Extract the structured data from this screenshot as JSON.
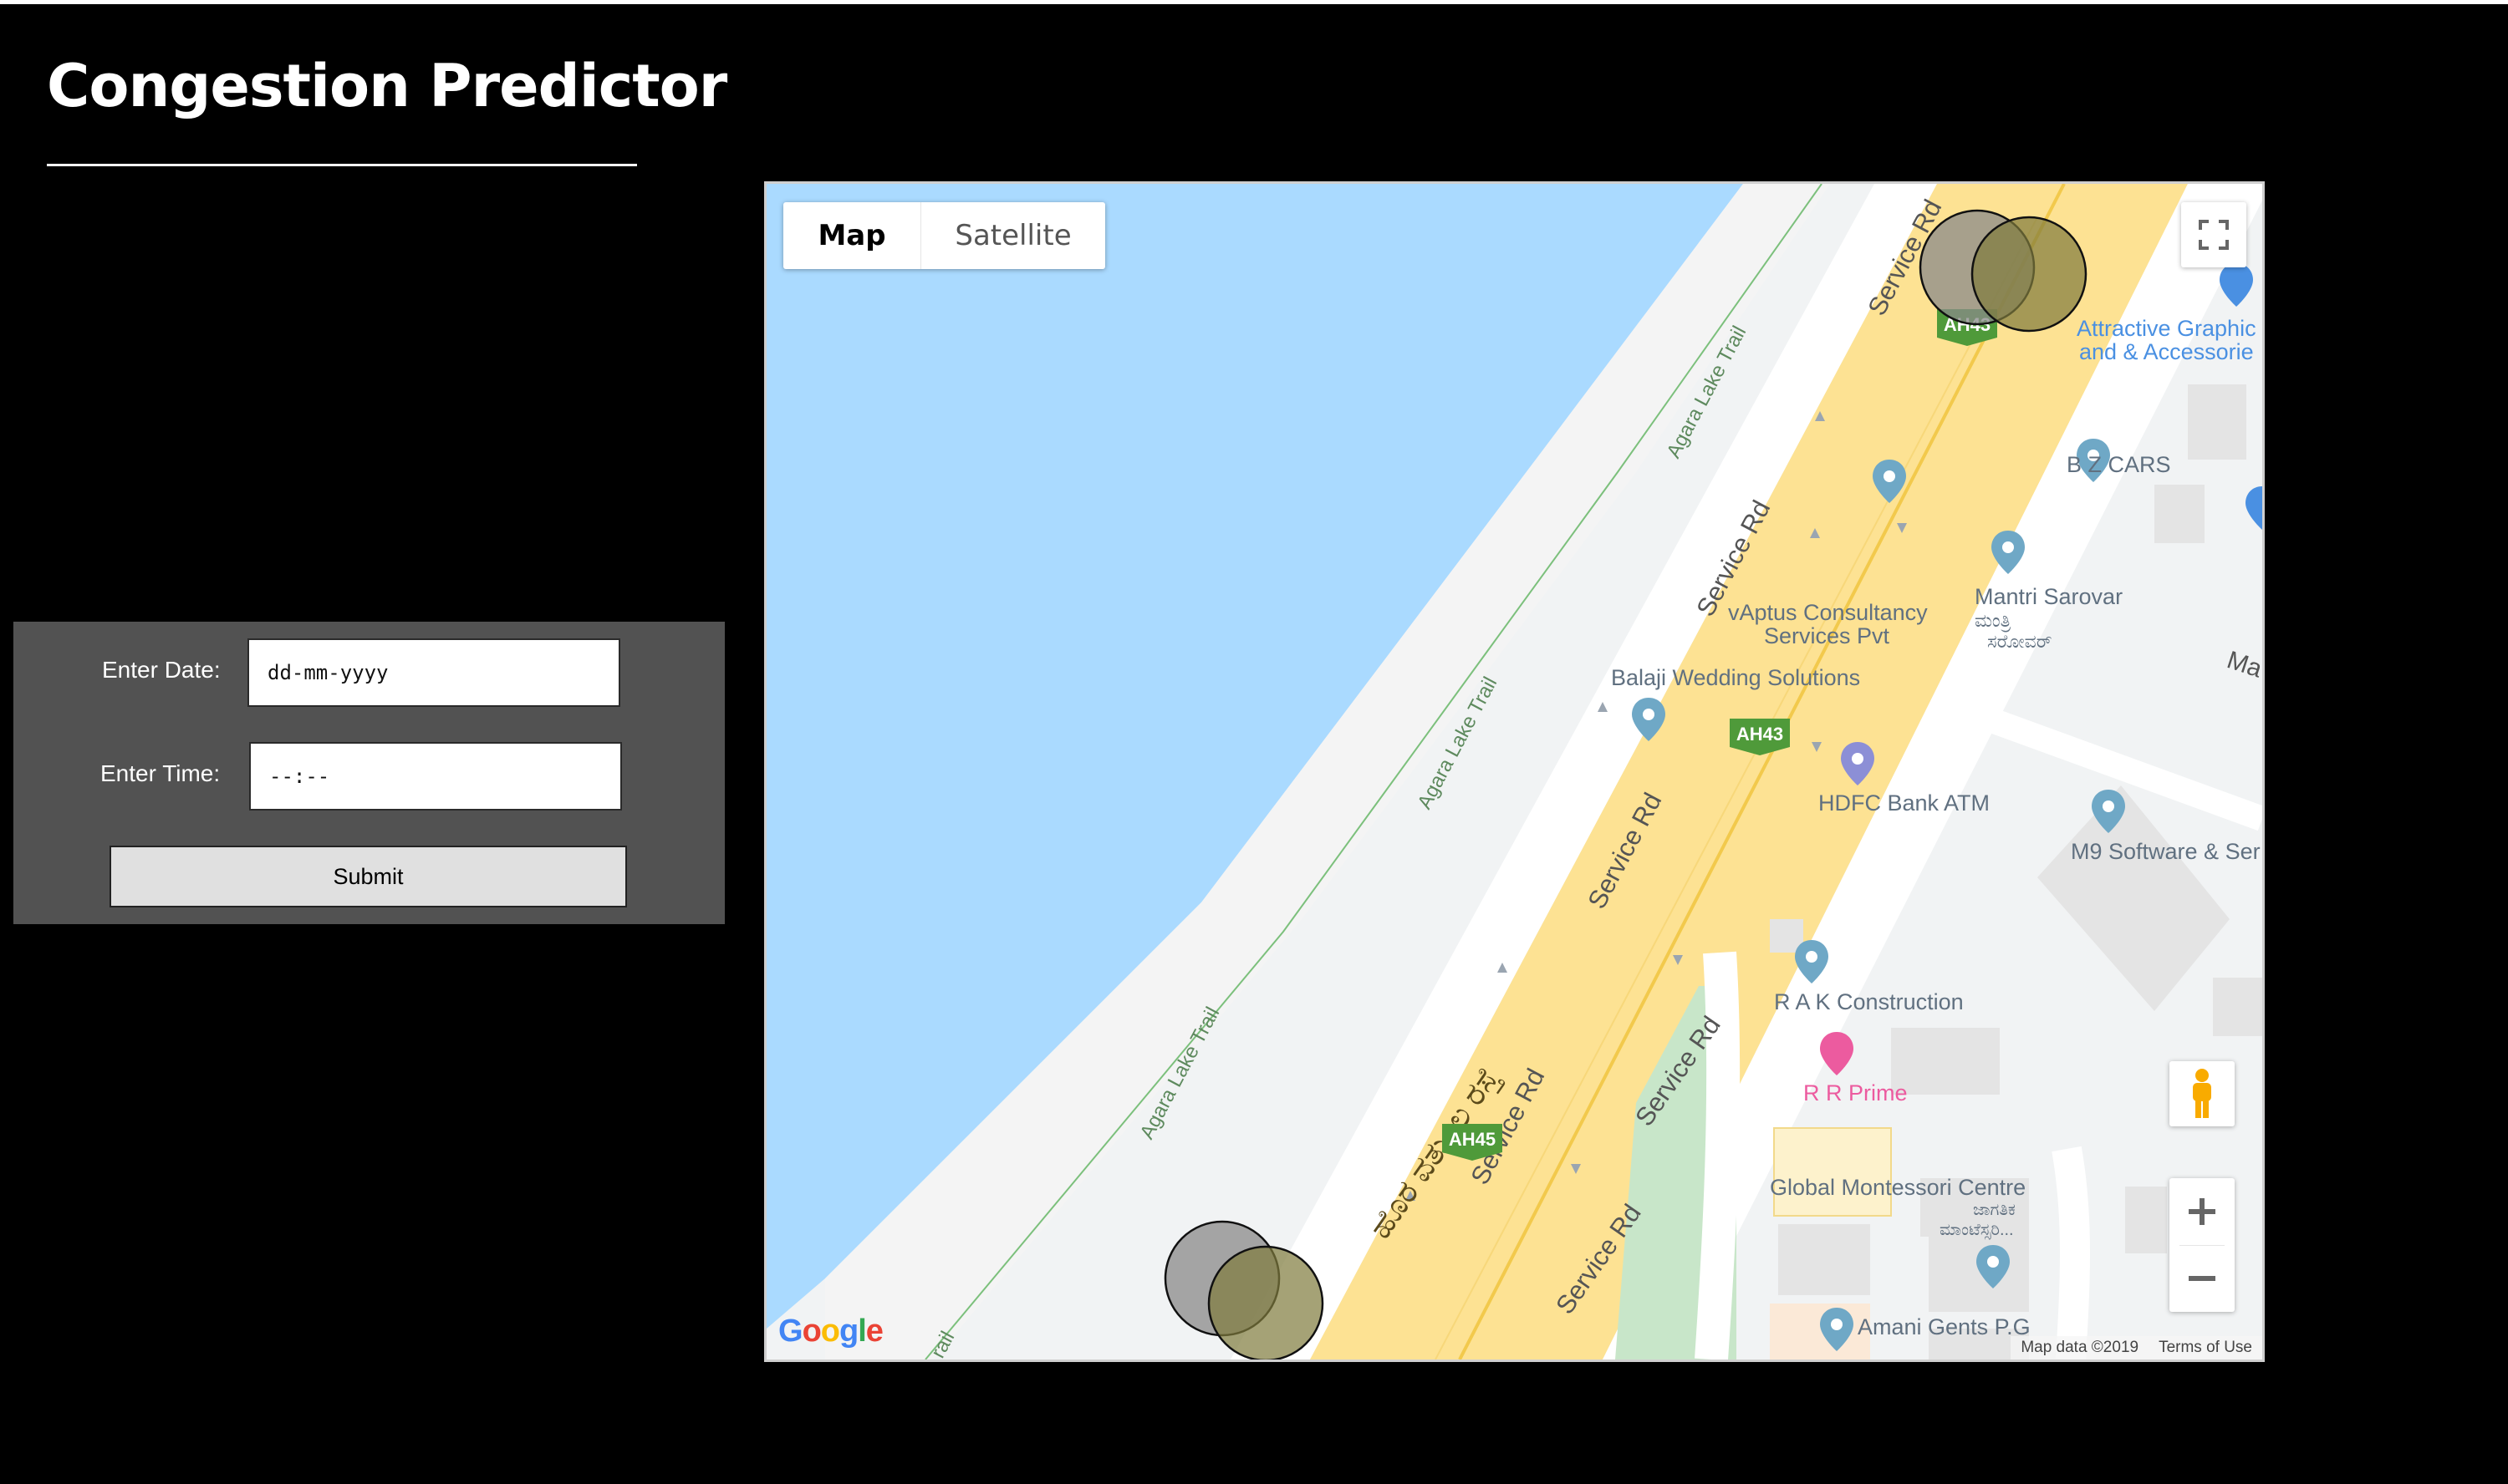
{
  "app": {
    "title": "Congestion Predictor"
  },
  "form": {
    "date_label": "Enter Date:",
    "date_placeholder": "dd-mm-yyyy",
    "time_label": "Enter Time:",
    "time_placeholder": "--:--",
    "submit_label": "Submit"
  },
  "map": {
    "map_type": {
      "options": [
        "Map",
        "Satellite"
      ],
      "selected": "Map"
    },
    "labels": {
      "service_rd": "Service Rd",
      "agara_trail": "Agara Lake Trail",
      "kannada_road": "ಹೊರ ವರ್ತುಲ ರಸ್ತೆ",
      "ah43": "AH43",
      "ah45": "AH45",
      "attractive_1": "Attractive Graphic",
      "attractive_2": "and & Accessorie",
      "bz_cars": "B Z CARS",
      "vaptus_1": "vAptus Consultancy",
      "vaptus_2": "Services Pvt",
      "mantri": "Mantri Sarovar",
      "mantri_kn_1": "ಮಂತ್ರಿ",
      "mantri_kn_2": "ಸರೋವರ್",
      "ma": "Ma",
      "balaji": "Balaji Wedding Solutions",
      "hdfc": "HDFC Bank ATM",
      "m9": "M9 Software & Ser",
      "rak": "R A K Construction",
      "rr_prime": "R R Prime",
      "montessori": "Global Montessori Centre",
      "montessori_kn_1": "ಜಾಗತಿಕ",
      "montessori_kn_2": "ಮಾಂಟೆಸ್ಸರಿ...",
      "amani": "Amani Gents P.G",
      "trail_cut": "rail"
    },
    "footer": {
      "map_data": "Map data ©2019",
      "terms": "Terms of Use"
    },
    "logo_text": "Google",
    "colors": {
      "water": "#aadaff",
      "highway": "#fde293",
      "park": "#c8e6c9",
      "shield": "#4f9a3a",
      "poi_pin": "#6fa8c6",
      "prime_pin": "#ec5b9f",
      "congestion_circle": "#7f7a3c"
    }
  }
}
